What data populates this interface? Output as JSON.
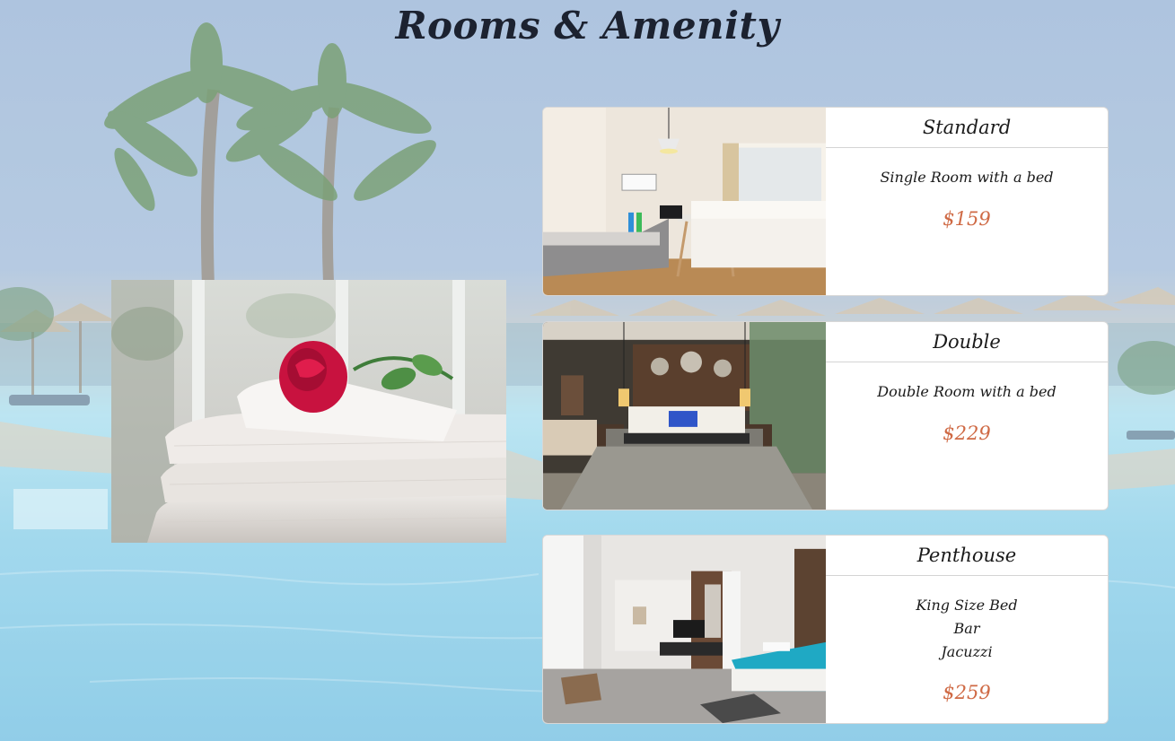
{
  "page": {
    "title": "Rooms & Amenity"
  },
  "rooms": [
    {
      "name": "Standard",
      "description": [
        "Single Room with a bed"
      ],
      "price": "$159"
    },
    {
      "name": "Double",
      "description": [
        "Double Room with a bed"
      ],
      "price": "$229"
    },
    {
      "name": "Penthouse",
      "description": [
        "King Size Bed",
        "Bar",
        "Jacuzzi"
      ],
      "price": "$259"
    }
  ],
  "colors": {
    "price": "#cf6a45",
    "title": "#1c2230",
    "card_background": "#ffffff"
  }
}
